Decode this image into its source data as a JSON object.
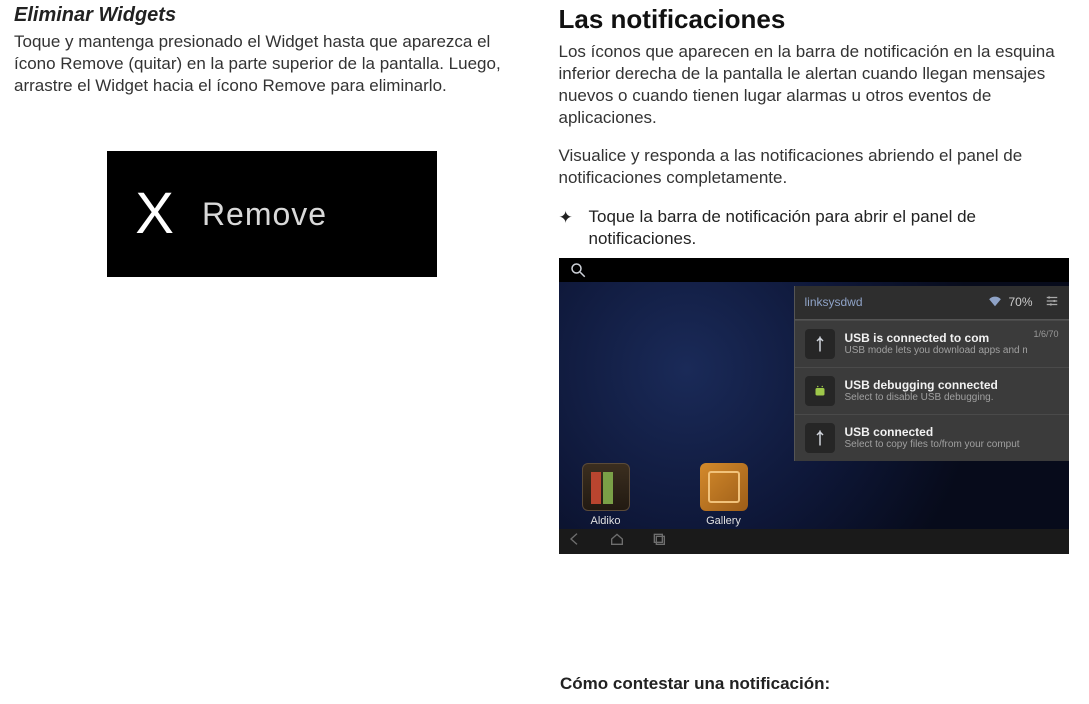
{
  "left": {
    "heading": "Eliminar Widgets",
    "para": "Toque y mantenga presionado el Widget hasta que aparezca el ícono Remove (quitar) en la parte superior de la pantalla. Luego, arrastre el Widget hacia el ícono Remove para eliminarlo.",
    "remove_label": "Remove"
  },
  "right": {
    "heading": "Las notificaciones",
    "para1": "Los íconos que aparecen en la barra de notificación en la esquina inferior derecha de la pantalla le alertan cuando llegan mensajes nuevos o cuando tienen lugar alarmas u otros eventos de aplicaciones.",
    "para2": "Visualice y responda a las notificaciones abriendo el panel de notificaciones completamente.",
    "bullet1": "Toque la barra de notificación para abrir el panel de notificaciones."
  },
  "shot": {
    "wifi_name": "linksysdwd",
    "battery": "70%",
    "apps": {
      "aldiko": "Aldiko",
      "gallery": "Gallery"
    },
    "notifs": [
      {
        "title": "USB is connected to com",
        "sub": "USB mode lets you download apps and m",
        "date": "1/6/70"
      },
      {
        "title": "USB debugging connected",
        "sub": "Select to disable USB debugging."
      },
      {
        "title": "USB connected",
        "sub": "Select to copy files to/from your comput"
      }
    ]
  },
  "bottom": "Cómo contestar una notificación:"
}
